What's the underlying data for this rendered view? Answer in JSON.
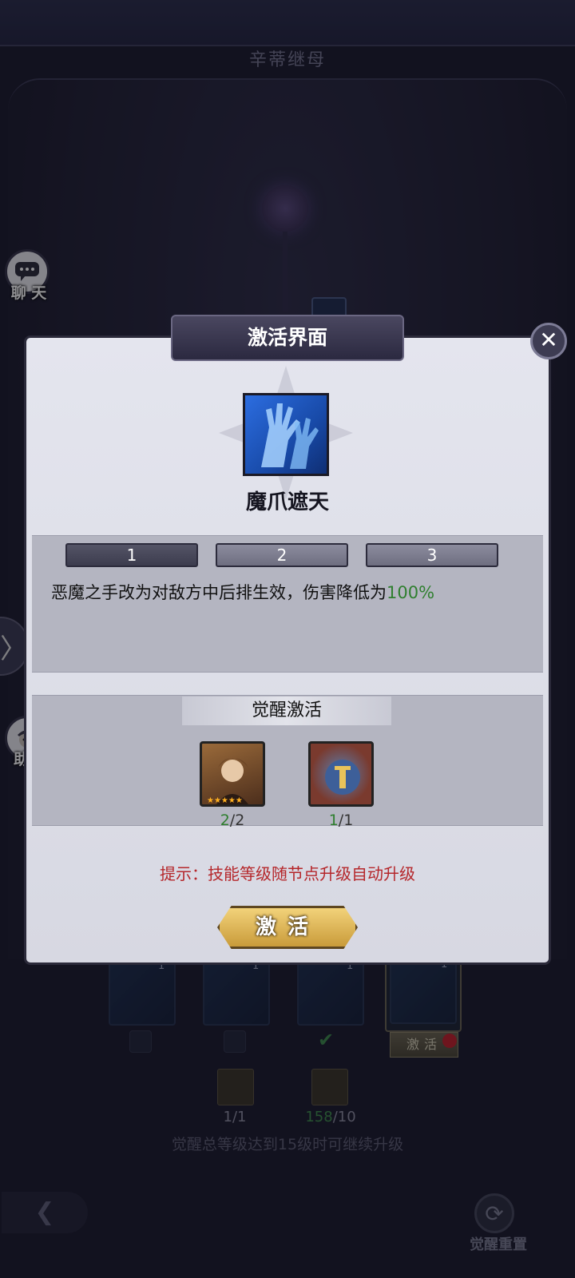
{
  "background": {
    "title": "辛蒂继母",
    "chat_label": "聊 天",
    "helper_label": "助手",
    "expand_glyph": "〉",
    "slots": [
      {
        "level": "1",
        "checked": false
      },
      {
        "level": "1",
        "checked": false
      },
      {
        "level": "1",
        "checked": true
      },
      {
        "level": "1",
        "checked": false
      }
    ],
    "slot_activate_label": "激活",
    "material1_count": "1/1",
    "material2_have": "158",
    "material2_need": "/10",
    "hint": "觉醒总等级达到15级时可继续升级",
    "reset_label": "觉醒重置"
  },
  "dialog": {
    "title": "激活界面",
    "close_glyph": "✕",
    "skill_name": "魔爪遮天",
    "levels": [
      "1",
      "2",
      "3"
    ],
    "selected_level": "1",
    "description": "恶魔之手改为对敌方中后排生效，伤害降低为",
    "description_value": "100%",
    "awaken_header": "觉醒激活",
    "requirements": [
      {
        "have": "2",
        "need": "/2",
        "icon": "character-portrait-icon"
      },
      {
        "have": "1",
        "need": "/1",
        "icon": "mask-emblem-icon"
      }
    ],
    "tip": "提示：技能等级随节点升级自动升级",
    "activate_label": "激活"
  },
  "colors": {
    "accent_green": "#2f7f2f",
    "tip_red": "#b5262a",
    "button_gold": "#e2b95a"
  }
}
